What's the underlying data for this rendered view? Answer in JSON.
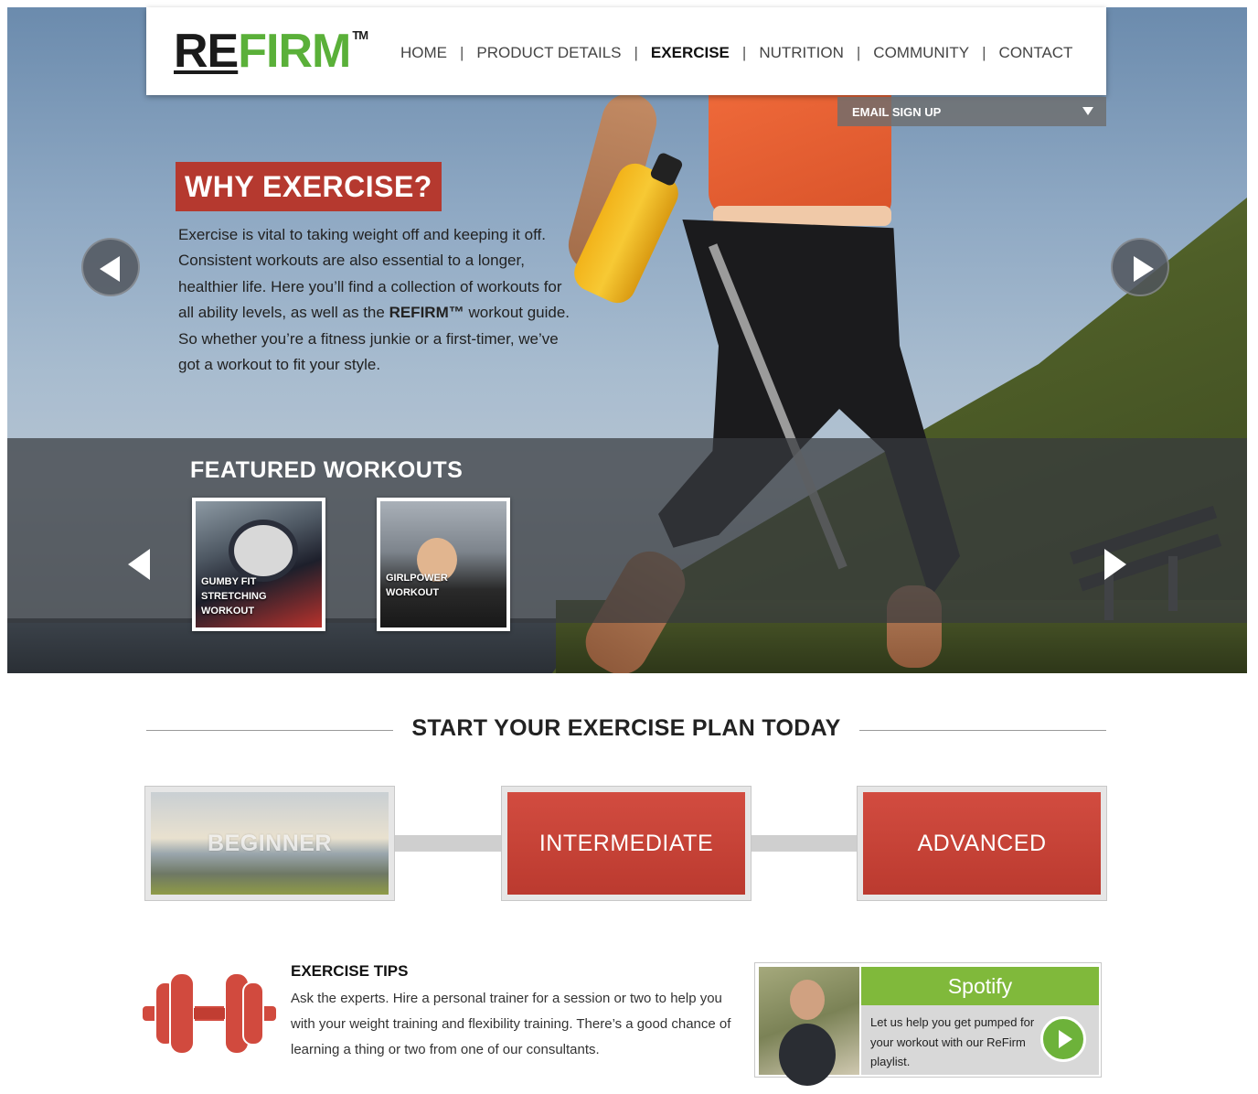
{
  "brand": {
    "logo_re": "RE",
    "logo_firm": "FIRM",
    "logo_tm": "TM",
    "green": "#5ab039",
    "accent_red": "#b5392f"
  },
  "nav": {
    "items": [
      "HOME",
      "PRODUCT DETAILS",
      "EXERCISE",
      "NUTRITION",
      "COMMUNITY",
      "CONTACT"
    ],
    "separator": "|",
    "active": "EXERCISE"
  },
  "email_signup": {
    "label": "EMAIL SIGN UP",
    "icon": "caret-down-icon"
  },
  "hero": {
    "title": "WHY EXERCISE?",
    "body_1": "Exercise is vital to taking weight off and keeping it off. Consistent workouts are also essential to a longer, healthier life. Here you’ll find a collection of workouts for all ability levels, as well as the",
    "body_brand": "REFIRM™",
    "body_2": "workout guide. So whether you’re a fitness junkie or a first-timer, we’ve got a workout to fit your style.",
    "prev_icon": "chevron-left-icon",
    "next_icon": "chevron-right-icon"
  },
  "featured": {
    "title": "FEATURED WORKOUTS",
    "workouts": [
      {
        "label_lines": [
          "GUMBY FIT",
          "STRETCHING",
          "WORKOUT"
        ]
      },
      {
        "label_lines": [
          "GIRLPOWER",
          "WORKOUT"
        ]
      }
    ]
  },
  "plan": {
    "heading": "START YOUR EXERCISE PLAN TODAY",
    "levels": [
      "BEGINNER",
      "INTERMEDIATE",
      "ADVANCED"
    ]
  },
  "tips": {
    "title": "EXERCISE TIPS",
    "body": "Ask the experts. Hire a personal trainer for a session or two to help you with your weight training and flexibility training. There’s a good chance of learning a thing or two from one of our consultants.",
    "icon": "dumbbell-icon"
  },
  "spotify": {
    "brand": "Spotify",
    "message": "Let us help you get pumped for your workout with our ReFirm playlist.",
    "icon": "play-icon",
    "green": "#80b93b"
  }
}
